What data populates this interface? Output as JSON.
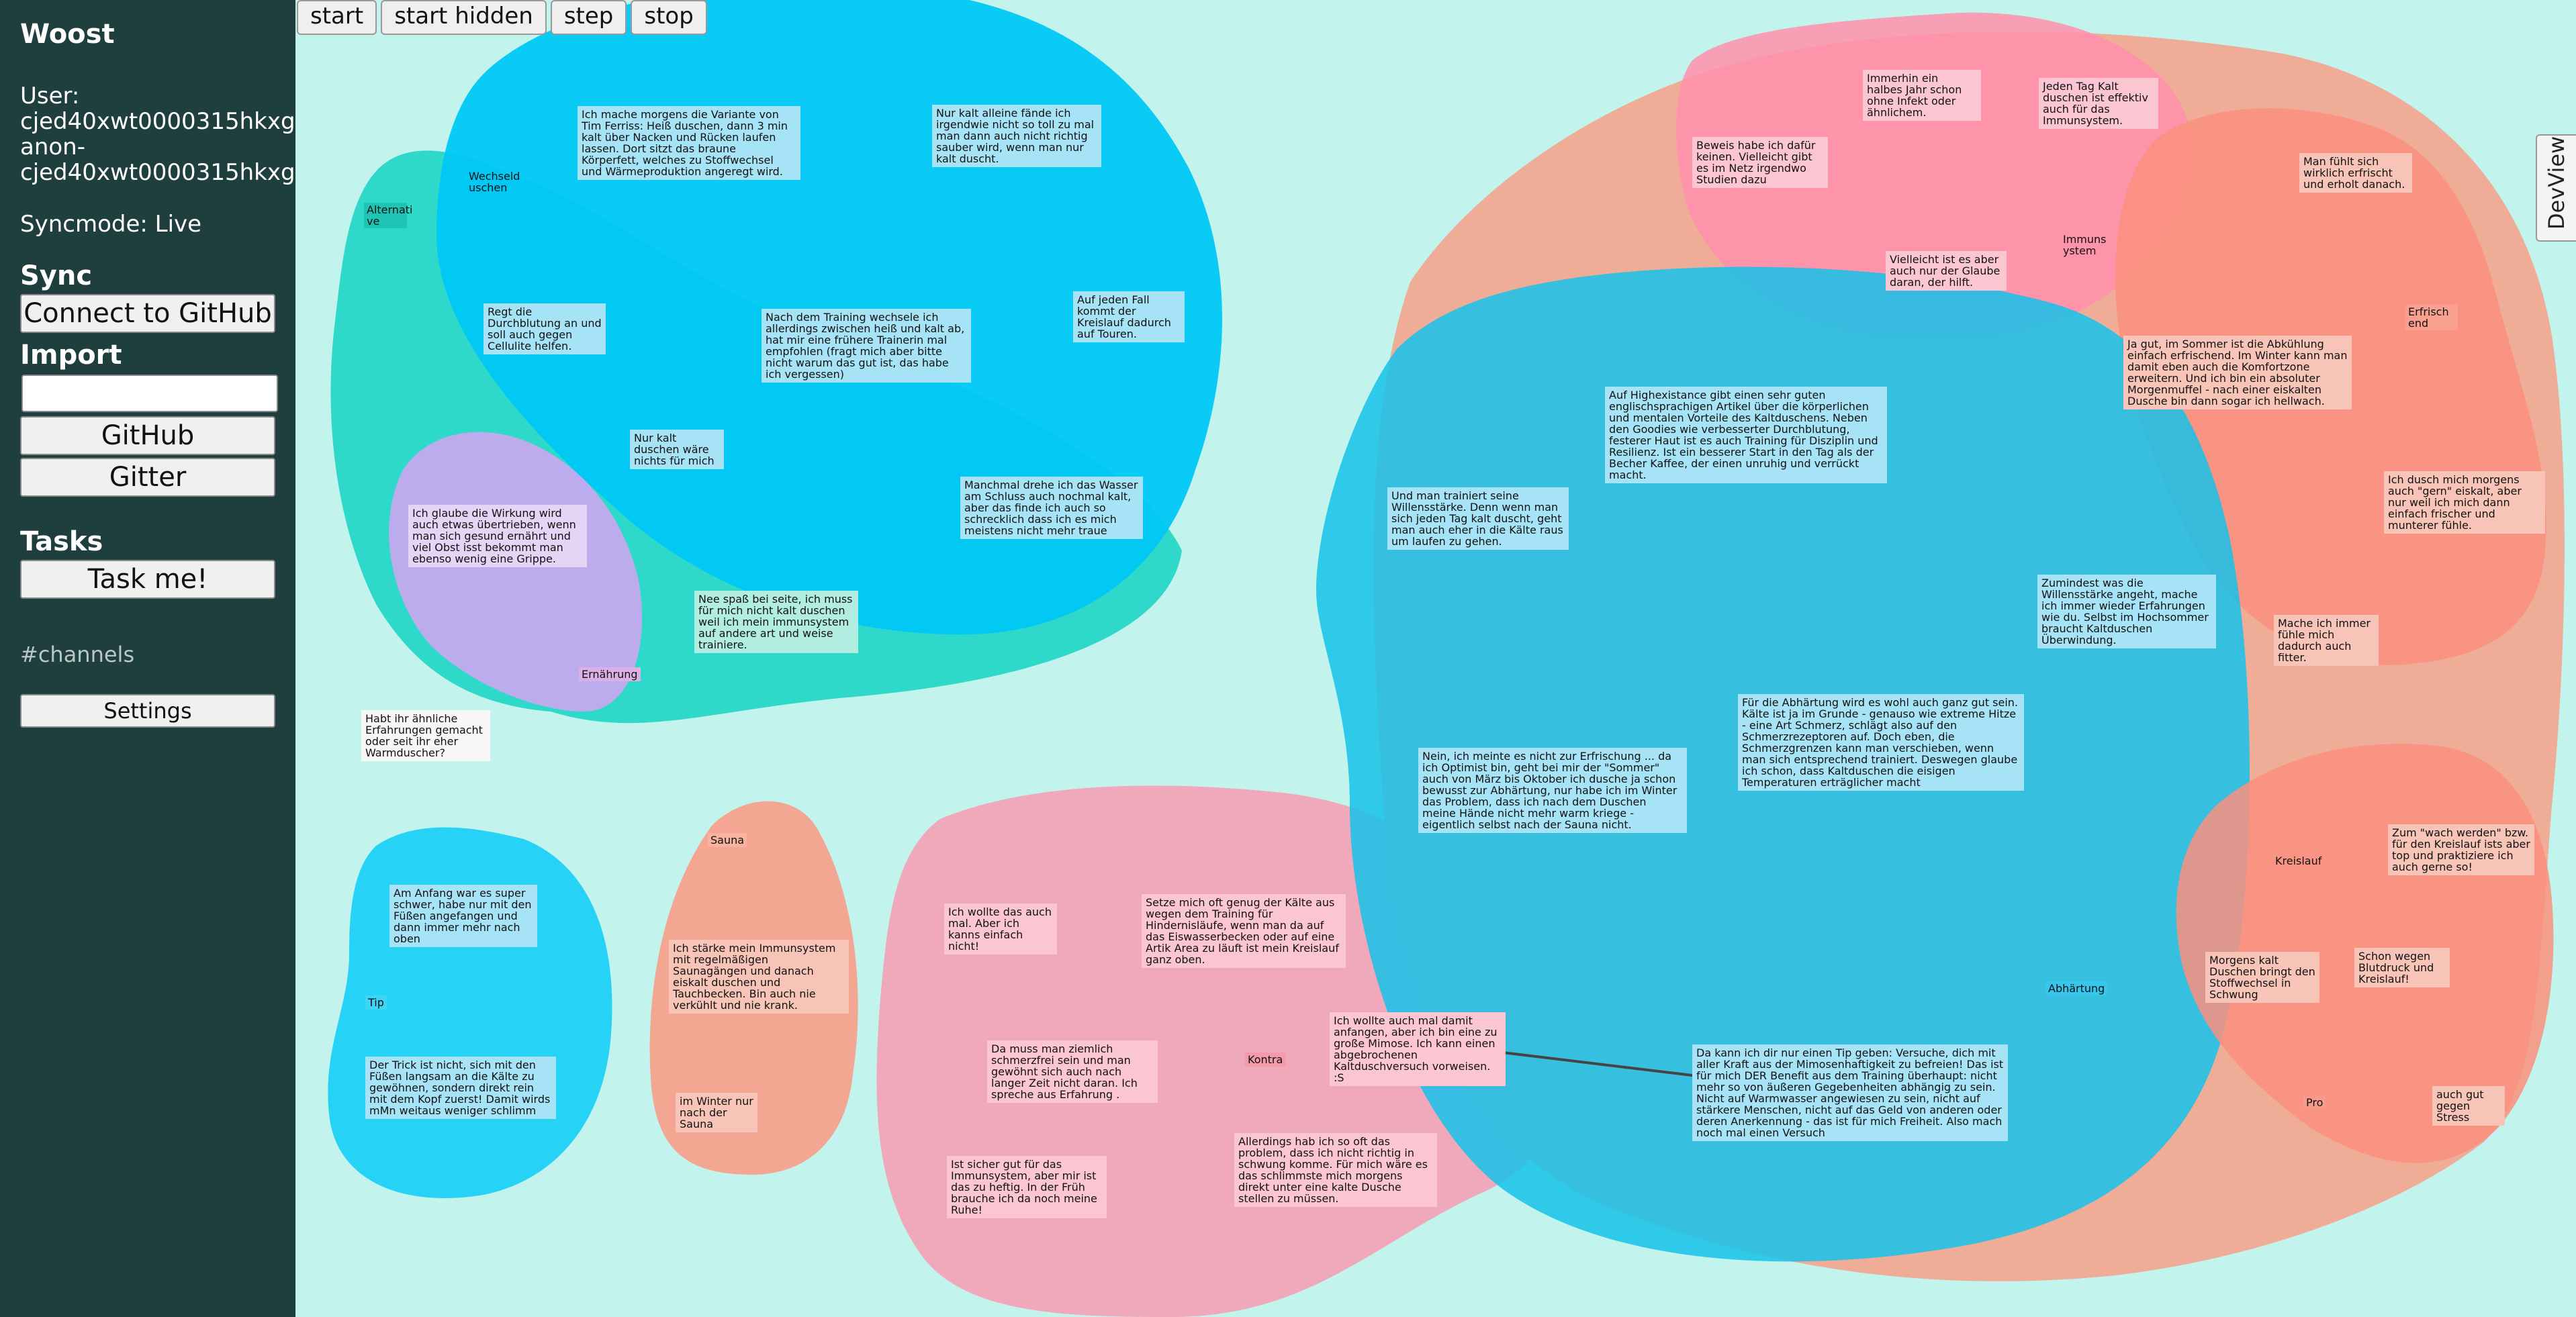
{
  "sidebar": {
    "title": "Woost",
    "user_label": "User:",
    "user_id": "cjed40xwt0000315hkxgla",
    "anon_label": "anon-",
    "anon_id": "cjed40xwt0000315hkxgla",
    "sync_mode": "Syncmode: Live",
    "sync_heading": "Sync",
    "connect_button": "Connect to GitHub",
    "import_heading": "Import",
    "import_input_value": "",
    "github_button": "GitHub",
    "gitter_button": "Gitter",
    "tasks_heading": "Tasks",
    "task_button": "Task me!",
    "channels": "#channels",
    "settings_button": "Settings"
  },
  "toolbar": {
    "start": "start",
    "start_hidden": "start hidden",
    "step": "step",
    "stop": "stop"
  },
  "devview": "DevView",
  "colors": {
    "background": "#c2f3ec",
    "sidebar": "#1e3f3d",
    "cyan": "#00c8f5",
    "teal": "#1fd6c6",
    "pink": "#ff8fab",
    "salmon": "#f7a08a",
    "lavender": "#c9a8f0"
  },
  "groups": {
    "alternative": "Alternati ve",
    "ernaehrung": "Ernährung",
    "sauna": "Sauna",
    "tip": "Tip",
    "kontra": "Kontra",
    "immunsystem": "Immuns ystem",
    "erfrischend": "Erfrisch end",
    "kreislauf": "Kreislauf",
    "abhaertung": "Abhärtung",
    "pro": "Pro"
  },
  "notes": {
    "wechseldusche": "Wechseld uschen",
    "tim_ferriss": "Ich mache morgens die Variante von Tim Ferriss: Heiß duschen, dann 3 min kalt über Nacken und Rücken laufen lassen. Dort sitzt das braune Körperfett, welches zu Stoffwechsel und Wärmeproduktion angeregt wird.",
    "nur_kalt": "Nur kalt alleine fände ich irgendwie nicht so toll zu mal man dann auch nicht richtig sauber wird, wenn man nur kalt duscht.",
    "durchblutung": "Regt die Durchblutung an und soll auch gegen Cellulite helfen.",
    "training_wechsel": "Nach dem Training wechsele ich allerdings zwischen heiß und kalt ab, hat mir eine frühere Trainerin mal empfohlen (fragt mich aber bitte nicht warum das gut ist, das habe ich vergessen)",
    "kreislauf_touren": "Auf jeden Fall kommt der Kreislauf dadurch auf Touren.",
    "nur_kalt_nichts": "Nur kalt duschen wäre nichts für mich",
    "schluss_kalt": "Manchmal drehe ich das Wasser am Schluss auch nochmal kalt, aber das finde ich auch so schrecklich dass ich es mich meistens nicht mehr traue",
    "wirkung": "Ich glaube die Wirkung wird auch etwas übertrieben, wenn man sich gesund ernährt und viel Obst isst bekommt man ebenso wenig eine Grippe.",
    "immunsystem_trainiere": "Nee spaß bei seite, ich muss für mich nicht kalt duschen weil ich mein immunsystem auf andere art und weise trainiere.",
    "aehnliche": "Habt ihr ähnliche Erfahrungen gemacht oder seit ihr eher Warmduscher?",
    "anfang": "Am Anfang war es super schwer, habe nur mit den Füßen angefangen und dann immer mehr nach oben",
    "trick": "Der Trick ist nicht, sich mit den Füßen langsam an die Kälte zu gewöhnen, sondern direkt rein mit dem Kopf zuerst! Damit wirds mMn weitaus weniger schlimm",
    "sauna_immun": "Ich stärke mein Immunsystem mit regelmäßigen Saunagängen und danach eiskalt duschen und Tauchbecken. Bin auch nie verkühlt und nie krank.",
    "winter_sauna": "im Winter nur nach der Sauna",
    "kanns_nicht": "Ich wollte das auch mal. Aber ich kanns einfach nicht!",
    "hindernislaeufe": "Setze mich oft genug der Kälte aus wegen dem Training für Hindernisläufe, wenn man da auf das Eiswasserbecken oder auf eine Artik Area zu läuft ist mein Kreislauf ganz oben.",
    "schmerzfrei": "Da muss man ziemlich schmerzfrei sein und man gewöhnt sich auch nach langer Zeit nicht daran. Ich spreche aus Erfahrung .",
    "mimose": "Ich wollte auch mal damit anfangen, aber ich bin eine zu große Mimose. Ich kann einen abgebrochenen Kaltduschversuch vorweisen. :S",
    "zu_heftig": "Ist sicher gut für das Immunsystem, aber mir ist das zu heftig. In der Früh brauche ich da noch meine Ruhe!",
    "schwung": "Allerdings hab ich so oft das problem, dass ich nicht richtig in schwung komme. Für mich wäre es das schlimmste mich morgens direkt unter eine kalte Dusche stellen zu müssen.",
    "beweis": "Beweis habe ich dafür keinen. Vielleicht gibt es im Netz irgendwo Studien dazu",
    "halbes_jahr": "Immerhin ein halbes Jahr schon ohne Infekt oder ähnlichem.",
    "jeden_tag": "Jeden Tag Kalt duschen ist effektiv auch für das Immunsystem.",
    "glaube": "Vielleicht ist es aber auch nur der Glaube daran, der hilft.",
    "erfrischt": "Man fühlt sich wirklich erfrischt und erholt danach.",
    "sommer": "Ja gut, im Sommer ist die Abkühlung einfach erfrischend. Im Winter kann man damit eben auch die Komfortzone erweitern. Und ich bin ein absoluter Morgenmuffel - nach einer eiskalten Dusche bin dann sogar ich hellwach.",
    "highextasience": "Auf Highexistance gibt einen sehr guten englischsprachigen Artikel über die körperlichen und mentalen Vorteile des Kaltduschens. Neben den Goodies wie verbesserter Durchblutung, festerer Haut ist es auch Training für Disziplin und Resilienz. Ist ein besserer Start in den Tag als der Becher Kaffee, der einen unruhig und verrückt macht.",
    "willensstaerke": "Und man trainiert seine Willensstärke. Denn wenn man sich jeden Tag kalt duscht, geht man auch eher in die Kälte raus um laufen zu gehen.",
    "gern_eiskalt": "Ich dusch mich morgens auch \"gern\" eiskalt, aber nur weil ich mich dann einfach frischer und munterer fühle.",
    "willensstaerke_angeht": "Zumindest was die Willensstärke angeht, mache ich immer wieder Erfahrungen wie du. Selbst im Hochsommer braucht Kaltduschen Überwindung.",
    "fitter": "Mache ich immer fühle mich dadurch auch fitter.",
    "abhaertung_text": "Für die Abhärtung wird es wohl auch ganz gut sein. Kälte ist ja im Grunde - genauso wie extreme Hitze - eine Art Schmerz, schlägt also auf den Schmerzrezeptoren auf. Doch eben, die Schmerzgrenzen kann man verschieben, wenn man sich entsprechend trainiert. Deswegen glaube ich schon, dass Kaltduschen die eisigen Temperaturen erträglicher macht",
    "optimist": "Nein, ich meinte es nicht zur Erfrischung ... da ich Optimist bin, geht bei mir der \"Sommer\" auch von März bis Oktober ich dusche ja schon bewusst zur Abhärtung, nur habe ich im Winter das Problem, dass ich nach dem Duschen meine Hände nicht mehr warm kriege - eigentlich selbst nach der Sauna nicht.",
    "wach_werden": "Zum \"wach werden\" bzw. für den Kreislauf ists aber top und praktiziere ich auch gerne so!",
    "stoffwechsel": "Morgens kalt Duschen bringt den Stoffwechsel in Schwung",
    "blutdruck": "Schon wegen Blutdruck und Kreislauf!",
    "tip_text": "Da kann ich dir nur einen Tip geben: Versuche, dich mit aller Kraft aus der Mimosenhaftigkeit zu befreien! Das ist für mich DER Benefit aus dem Training überhaupt: nicht mehr so von äußeren Gegebenheiten abhängig zu sein. Nicht auf Warmwasser angewiesen zu sein, nicht auf stärkere Menschen, nicht auf das Geld von anderen oder deren Anerkennung - das ist für mich Freiheit. Also mach noch mal einen Versuch",
    "stress": "auch gut gegen Stress"
  }
}
